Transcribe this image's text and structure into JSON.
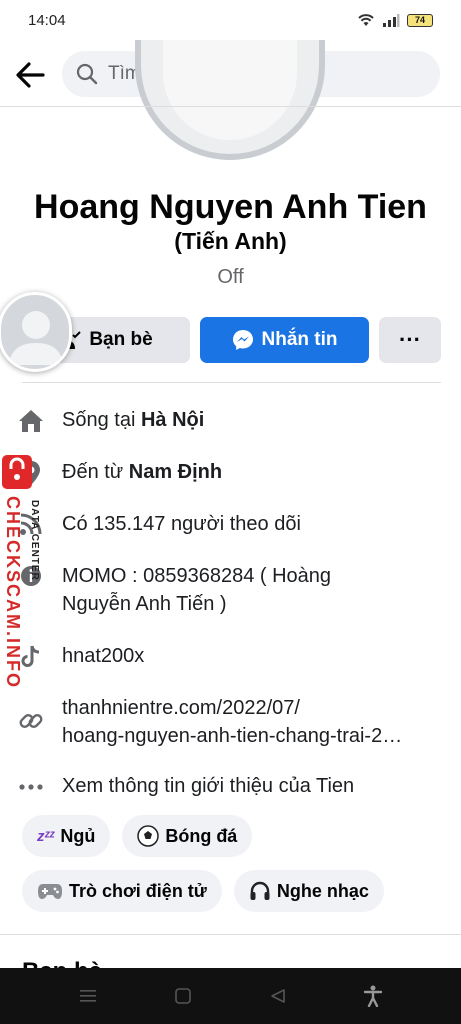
{
  "status": {
    "time": "14:04",
    "battery": "74"
  },
  "search": {
    "placeholder": "Tìm kiếm"
  },
  "profile": {
    "name": "Hoang Nguyen Anh Tien",
    "alt_name": "(Tiến Anh)",
    "bio": "Off"
  },
  "actions": {
    "friends": "Bạn bè",
    "message": "Nhắn tin",
    "more": "···"
  },
  "info": {
    "lives_prefix": "Sống tại ",
    "lives_city": "Hà Nội",
    "from_prefix": "Đến từ ",
    "from_city": "Nam Định",
    "followers": "Có 135.147 người theo dõi",
    "momo_line1": "MOMO : 0859368284 ( Hoàng",
    "momo_line2": "Nguyễn Anh Tiến )",
    "tiktok": "hnat200x",
    "link_line1": "thanhnientre.com/2022/07/",
    "link_line2": "hoang-nguyen-anh-tien-chang-trai-2…",
    "see_more": "Xem thông tin giới thiệu của Tien"
  },
  "hobbies": [
    {
      "label": "Ngủ",
      "icon": "zzz-icon"
    },
    {
      "label": "Bóng đá",
      "icon": "soccer-ball-icon"
    },
    {
      "label": "Trò chơi điện tử",
      "icon": "gamepad-icon"
    },
    {
      "label": "Nghe nhạc",
      "icon": "headphones-icon"
    }
  ],
  "sections": {
    "friends_title": "Bạn bè"
  },
  "watermark": {
    "main": "CHECKSCAM.INFO",
    "sub": "DATA CENTER"
  },
  "colors": {
    "accent": "#1b74e4",
    "chip_bg": "#f0f2f5",
    "watermark": "#d42a2a"
  }
}
